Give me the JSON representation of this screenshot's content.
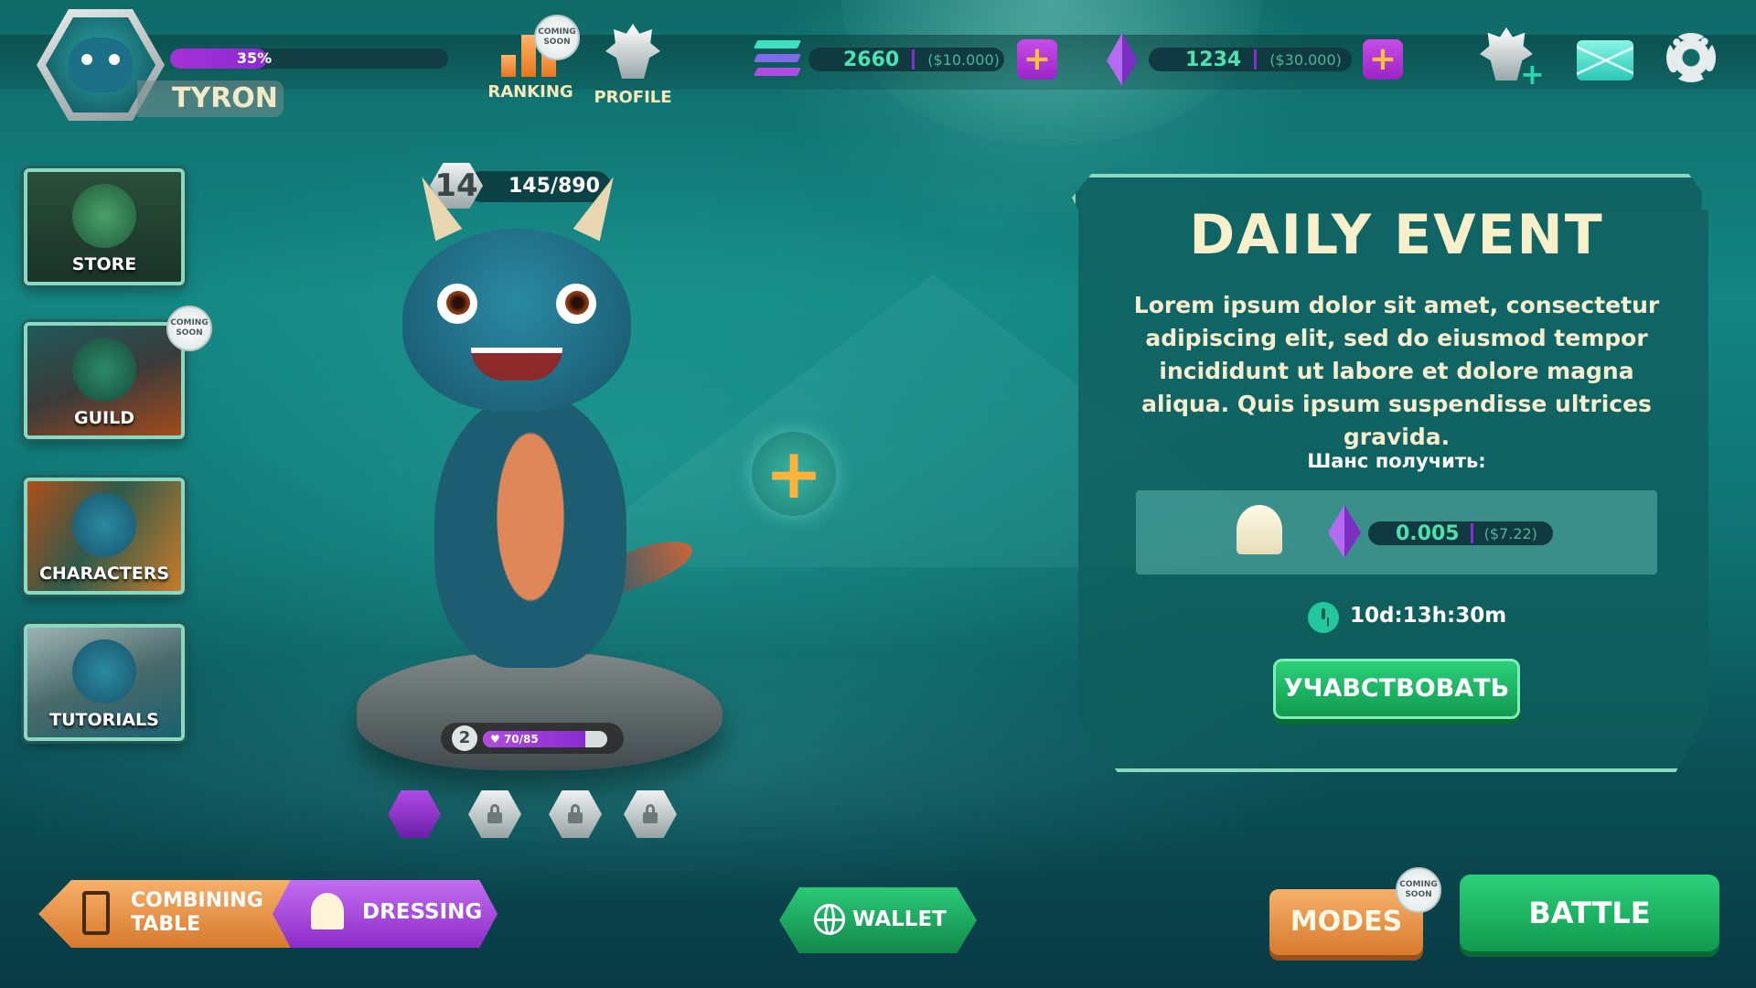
{
  "player": {
    "name": "TYRON",
    "xp_percent_label": "35%",
    "xp_fraction": 0.35
  },
  "top_nav": {
    "ranking_label": "RANKING",
    "profile_label": "PROFILE",
    "coming_soon_line1": "COMING",
    "coming_soon_line2": "SOON"
  },
  "currencies": [
    {
      "icon": "solana-icon",
      "value": "2660",
      "usd": "($10.000)"
    },
    {
      "icon": "ethereum-icon",
      "value": "1234",
      "usd": "($30.000)"
    }
  ],
  "plus_glyph": "+",
  "header_icons": [
    "add-friend-icon",
    "mail-icon",
    "gear-icon"
  ],
  "side_menu": [
    {
      "label": "STORE"
    },
    {
      "label": "GUILD",
      "coming_soon": true
    },
    {
      "label": "CHARACTERS"
    },
    {
      "label": "TUTORIALS"
    }
  ],
  "character": {
    "level": "14",
    "xp": "145/890",
    "pet_level": "2",
    "pet_progress": "70/85",
    "pet_fraction": 0.8235,
    "slots": [
      "active",
      "locked",
      "locked",
      "locked"
    ]
  },
  "event": {
    "title": "DAILY  EVENT",
    "description": "Lorem ipsum dolor sit amet, consectetur adipiscing elit, sed do eiusmod tempor incididunt ut labore et dolore magna aliqua. Quis ipsum suspendisse ultrices gravida.",
    "chance_label": "Шанс получить:",
    "reward_value": "0.005",
    "reward_usd": "($7.22)",
    "timer": "10d:13h:30m",
    "participate_label": "УЧАВСТВОВАТЬ"
  },
  "bottom": {
    "combining_line1": "COMBINING",
    "combining_line2": "TABLE",
    "dressing_label": "DRESSING",
    "wallet_label": "WALLET",
    "modes_label": "MODES",
    "battle_label": "BATTLE"
  },
  "colors": {
    "accent_green": "#2bd07a",
    "accent_purple": "#9b24c8",
    "accent_orange": "#e8761e",
    "currency_text": "#4fe0b0"
  }
}
